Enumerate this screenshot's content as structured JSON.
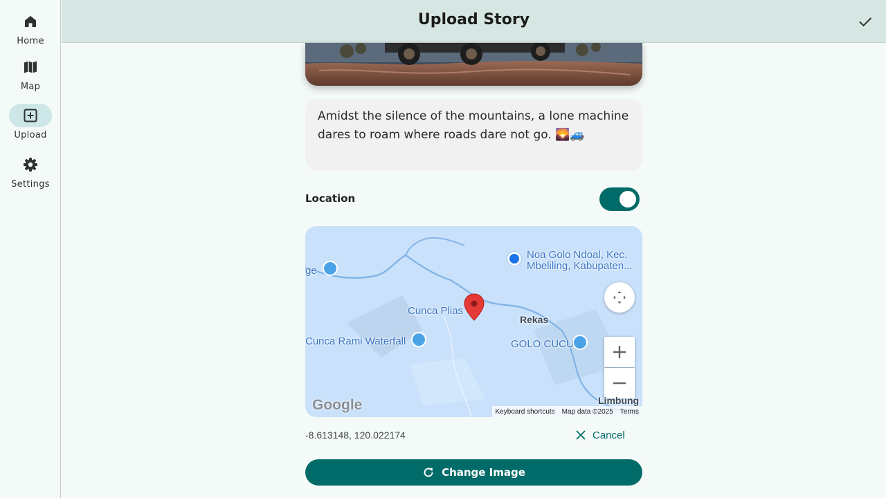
{
  "nav": {
    "items": [
      {
        "label": "Home",
        "icon": "home-icon"
      },
      {
        "label": "Map",
        "icon": "map-icon"
      },
      {
        "label": "Upload",
        "icon": "add-box-icon",
        "active": true
      },
      {
        "label": "Settings",
        "icon": "gear-icon"
      }
    ]
  },
  "header": {
    "title": "Upload Story",
    "confirm_icon": "check-icon"
  },
  "caption": {
    "text": "Amidst the silence of the mountains, a lone machine dares to roam where roads dare not go. 🌄🚙"
  },
  "location": {
    "label": "Location",
    "enabled": true,
    "coordinates": "-8.613148, 120.022174",
    "cancel_label": "Cancel"
  },
  "map": {
    "labels": {
      "place_top_1": "Noa Golo Ndoal, Kec.",
      "place_top_2": "Mbeliling, Kabupaten...",
      "edge_label": "ge",
      "cunca_plias": "Cunca Plias",
      "rekas": "Rekas",
      "cunca_rami": "Cunca Rami Waterfall",
      "golo_cucu": "GOLO CUCU",
      "limbung": "Limbung"
    },
    "logo": "Google",
    "attribution": {
      "shortcuts": "Keyboard shortcuts",
      "map_data": "Map data ©2025",
      "terms": "Terms"
    }
  },
  "actions": {
    "change_image_label": "Change Image"
  },
  "colors": {
    "primary": "#006b68",
    "header_bg": "#d6e6e3",
    "nav_active": "#cde7e8",
    "marker": "#e53935"
  }
}
